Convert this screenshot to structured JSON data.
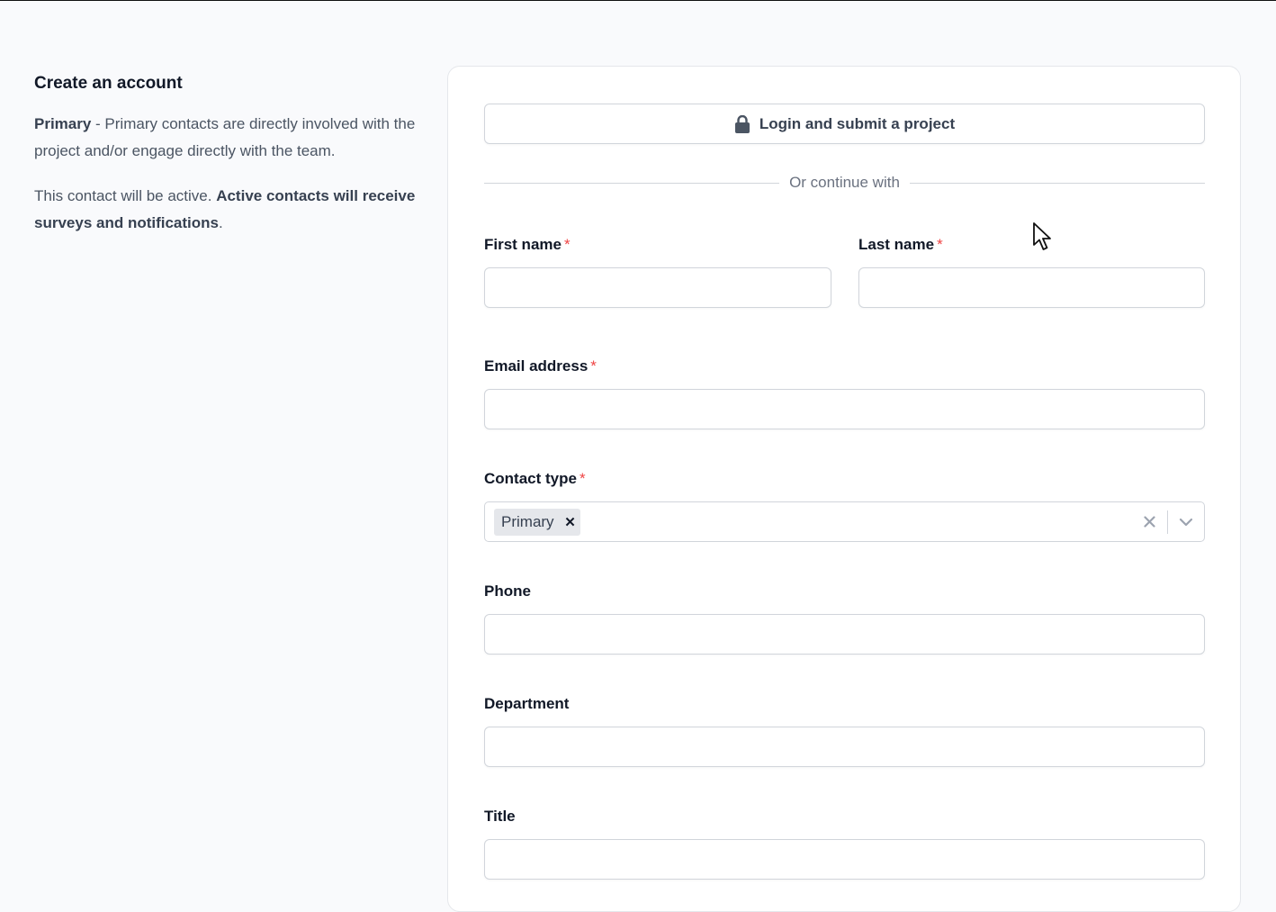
{
  "left": {
    "title": "Create an account",
    "primary_bold": "Primary",
    "primary_text": " - Primary contacts are directly involved with the project and/or engage directly with the team.",
    "active_text": "This contact will be active. ",
    "active_bold": "Active contacts will receive surveys and notifications",
    "active_end": "."
  },
  "form": {
    "login_button": "Login and submit a project",
    "divider": "Or continue with",
    "first_name": {
      "label": "First name",
      "value": ""
    },
    "last_name": {
      "label": "Last name",
      "value": ""
    },
    "email": {
      "label": "Email address",
      "value": ""
    },
    "contact_type": {
      "label": "Contact type",
      "selected": "Primary"
    },
    "phone": {
      "label": "Phone",
      "value": ""
    },
    "department": {
      "label": "Department",
      "value": ""
    },
    "title": {
      "label": "Title",
      "value": ""
    },
    "required_mark": "*"
  },
  "colors": {
    "required": "#ef4444",
    "border": "#d1d5db",
    "background": "#f9fafc"
  },
  "icons": {
    "login": "lock-icon",
    "chip_remove": "close-icon",
    "clear": "clear-icon",
    "dropdown": "chevron-down-icon",
    "cursor": "mouse-cursor-icon"
  }
}
